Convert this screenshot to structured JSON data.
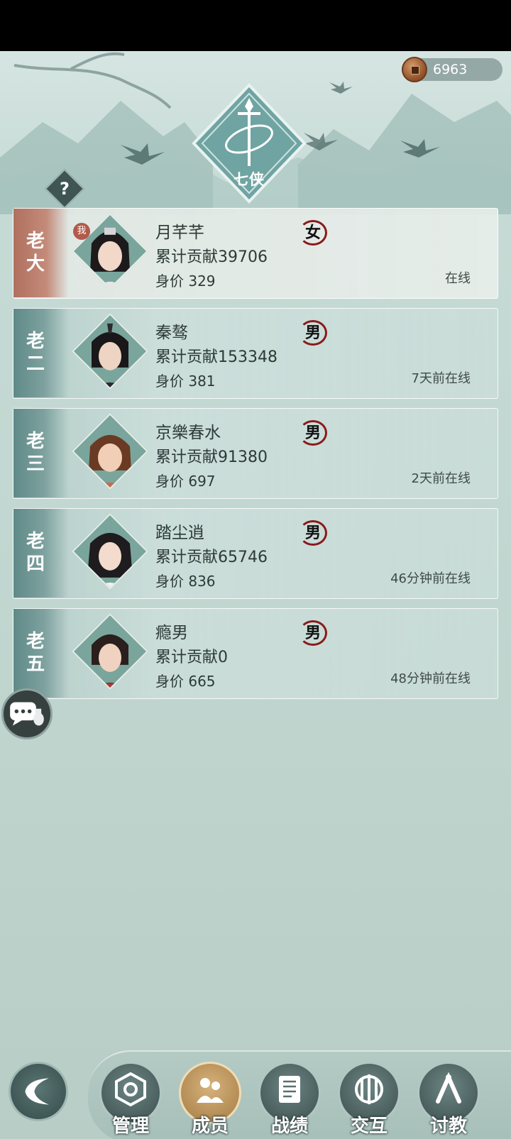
{
  "currency": {
    "value": "6963",
    "icon": "copper-coin-icon"
  },
  "header": {
    "emblem_name": "七侠",
    "help_label": "?"
  },
  "members": [
    {
      "rank": "老大",
      "name": "月芊芊",
      "contribution": "累计贡献39706",
      "worth": "身价 329",
      "gender": "女",
      "status": "在线",
      "is_self": true,
      "self_badge": "我"
    },
    {
      "rank": "老二",
      "name": "秦骜",
      "contribution": "累计贡献153348",
      "worth": "身价 381",
      "gender": "男",
      "status": "7天前在线",
      "is_self": false
    },
    {
      "rank": "老三",
      "name": "京樂春水",
      "contribution": "累计贡献91380",
      "worth": "身价 697",
      "gender": "男",
      "status": "2天前在线",
      "is_self": false
    },
    {
      "rank": "老四",
      "name": "踏尘逍",
      "contribution": "累计贡献65746",
      "worth": "身价 836",
      "gender": "男",
      "status": "46分钟前在线",
      "is_self": false
    },
    {
      "rank": "老五",
      "name": "瘾男",
      "contribution": "累计贡献0",
      "worth": "身价 665",
      "gender": "男",
      "status": "48分钟前在线",
      "is_self": false
    }
  ],
  "nav": {
    "tabs": [
      {
        "label": "管理",
        "icon": "manage-icon",
        "active": false
      },
      {
        "label": "成员",
        "icon": "members-icon",
        "active": true
      },
      {
        "label": "战绩",
        "icon": "record-scroll-icon",
        "active": false
      },
      {
        "label": "交互",
        "icon": "interact-icon",
        "active": false
      },
      {
        "label": "讨教",
        "icon": "challenge-icon",
        "active": false
      }
    ]
  },
  "colors": {
    "background": "#c3d8d2",
    "self_rank": "#b0705e",
    "rank": "#5f8a88",
    "gender_ring": "#8b1a1a"
  }
}
